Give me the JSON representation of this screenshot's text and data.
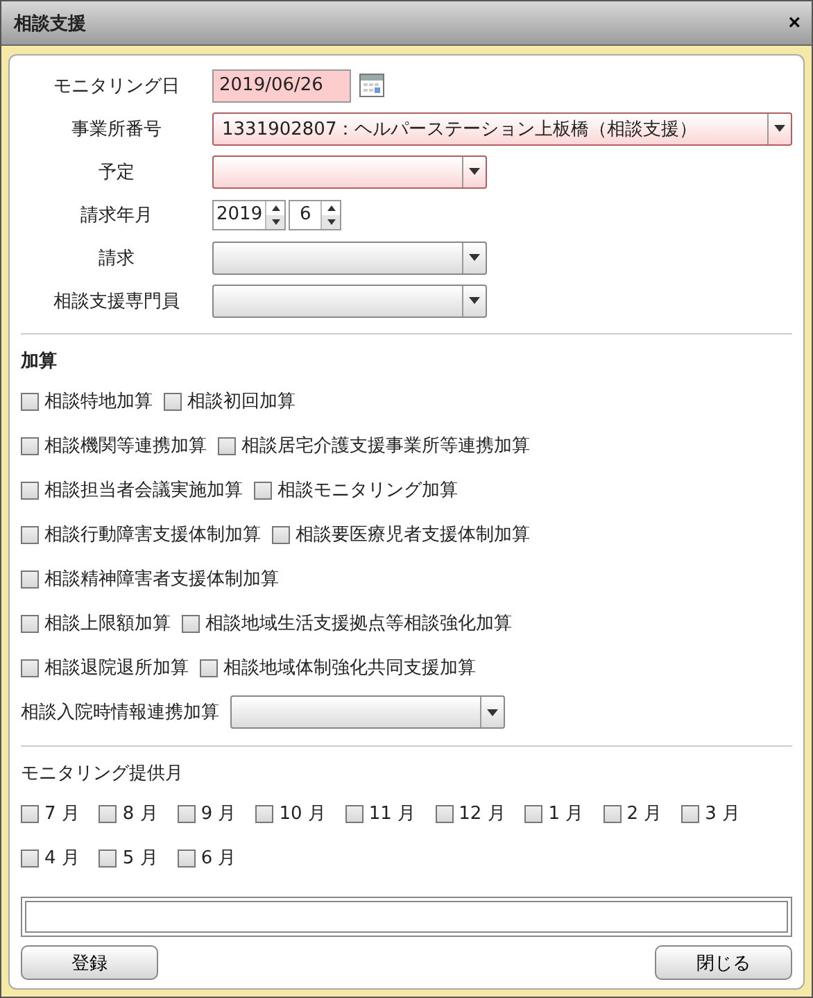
{
  "window": {
    "title": "相談支援",
    "close": "×"
  },
  "fields": [
    {
      "label": "モニタリング日",
      "kind": "date",
      "value": "2019/06/26",
      "required": true
    },
    {
      "label": "事業所番号",
      "kind": "wide-select",
      "value": "1331902807：ヘルパーステーション上板橋（相談支援）",
      "required": true
    },
    {
      "label": "予定",
      "kind": "select",
      "required": true
    },
    {
      "label": "請求年月",
      "kind": "year-month",
      "year": "2019",
      "month": "6"
    },
    {
      "label": "請求",
      "kind": "select",
      "required": false
    },
    {
      "label": "相談支援専門員",
      "kind": "select",
      "required": false
    }
  ],
  "additions": {
    "title": "加算",
    "rows": [
      [
        {
          "label": "相談特地加算",
          "checked": false
        },
        {
          "label": "相談初回加算",
          "checked": false
        }
      ],
      [
        {
          "label": "相談機関等連携加算",
          "checked": false
        },
        {
          "label": "相談居宅介護支援事業所等連携加算",
          "checked": false
        }
      ],
      [
        {
          "label": "相談担当者会議実施加算",
          "checked": false
        },
        {
          "label": "相談モニタリング加算",
          "checked": false
        }
      ],
      [
        {
          "label": "相談行動障害支援体制加算",
          "checked": false
        },
        {
          "label": "相談要医療児者支援体制加算",
          "checked": false
        }
      ],
      [
        {
          "label": "相談精神障害者支援体制加算",
          "checked": false
        }
      ],
      [
        {
          "label": "相談上限額加算",
          "checked": false
        },
        {
          "label": "相談地域生活支援拠点等相談強化加算",
          "checked": false
        }
      ],
      [
        {
          "label": "相談退院退所加算",
          "checked": false
        },
        {
          "label": "相談地域体制強化共同支援加算",
          "checked": false
        }
      ]
    ],
    "select_label": "相談入院時情報連携加算"
  },
  "months": {
    "title": "モニタリング提供月",
    "rows": [
      [
        {
          "label": "7 月",
          "checked": false
        },
        {
          "label": "8 月",
          "checked": false
        },
        {
          "label": "9 月",
          "checked": false
        },
        {
          "label": "10 月",
          "checked": false
        },
        {
          "label": "11 月",
          "checked": false
        },
        {
          "label": "12 月",
          "checked": false
        },
        {
          "label": "1 月",
          "checked": false
        },
        {
          "label": "2 月",
          "checked": false
        },
        {
          "label": "3 月",
          "checked": false
        }
      ],
      [
        {
          "label": "4 月",
          "checked": false
        },
        {
          "label": "5 月",
          "checked": false
        },
        {
          "label": "6 月",
          "checked": false
        }
      ]
    ]
  },
  "buttons": [
    "登録",
    "閉じる"
  ]
}
